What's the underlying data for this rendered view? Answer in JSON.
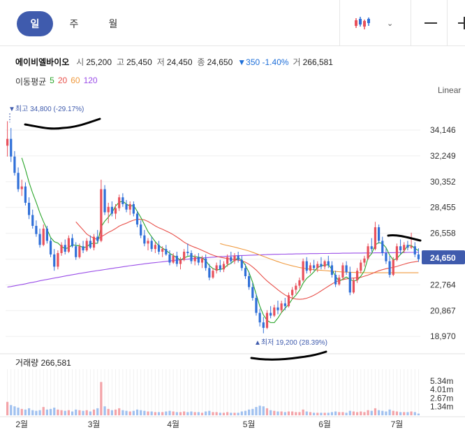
{
  "toolbar": {
    "tabs": [
      {
        "label": "일",
        "active": true
      },
      {
        "label": "주",
        "active": false
      },
      {
        "label": "월",
        "active": false
      }
    ],
    "chart_type_icon": "candlestick-icon",
    "dropdown_icon": "chevron-down-icon",
    "zoom_out_icon": "minus-icon",
    "zoom_in_icon": "plus-icon"
  },
  "stock": {
    "name": "에이비엘바이오",
    "open_label": "시",
    "open": "25,200",
    "high_label": "고",
    "high": "25,450",
    "low_label": "저",
    "low": "24,450",
    "close_label": "종",
    "close": "24,650",
    "change": "▼350 -1.40%",
    "volume_label": "거",
    "volume": "266,581"
  },
  "moving_average": {
    "label": "이동평균",
    "periods": [
      {
        "label": "5",
        "color": "#2aa52a"
      },
      {
        "label": "20",
        "color": "#e8504a"
      },
      {
        "label": "60",
        "color": "#f09a3e"
      },
      {
        "label": "120",
        "color": "#9a4ee8"
      }
    ]
  },
  "scale_mode": "Linear",
  "colors": {
    "up": "#e8505b",
    "down": "#2f6fd8",
    "price_badge": "#3f5bad",
    "accent": "#3f5bad"
  },
  "current_price_badge": "24,650",
  "annotations": {
    "high": "▼최고 34,800 (-29.17%)",
    "low": "▲최저 19,200 (28.39%)"
  },
  "volume_title": "거래량 266,581",
  "chart_data": {
    "type": "candlestick",
    "price_axis": {
      "ticks": [
        34146,
        32249,
        30352,
        28455,
        26558,
        24650,
        22764,
        20867,
        18970
      ],
      "tick_labels": [
        "34,146",
        "32,249",
        "30,352",
        "28,455",
        "26,558",
        "24,650",
        "22,764",
        "20,867",
        "18,970"
      ],
      "range": [
        18000,
        36000
      ]
    },
    "volume_axis": {
      "tick_labels": [
        "5.34m",
        "4.01m",
        "2.67m",
        "1.34m"
      ],
      "ticks": [
        5.34,
        4.01,
        2.67,
        1.34
      ],
      "range": [
        0,
        7.2
      ]
    },
    "x_labels": [
      "2월",
      "3월",
      "4월",
      "5월",
      "6월",
      "7월"
    ],
    "x_label_index": [
      4,
      24,
      46,
      67,
      88,
      108
    ],
    "high_point": {
      "index": 1,
      "value": 34800
    },
    "low_point": {
      "index": 72,
      "value": 19200
    },
    "candles": [
      [
        33000,
        34800,
        32200,
        33500,
        2.1
      ],
      [
        33500,
        34300,
        31800,
        32200,
        1.6
      ],
      [
        32200,
        32600,
        30800,
        31000,
        1.4
      ],
      [
        31000,
        31400,
        29600,
        29800,
        1.2
      ],
      [
        29800,
        30500,
        29300,
        30000,
        1.0
      ],
      [
        30000,
        30300,
        28600,
        28800,
        0.9
      ],
      [
        28800,
        29200,
        27600,
        27900,
        1.1
      ],
      [
        27900,
        28300,
        26900,
        27100,
        0.8
      ],
      [
        27100,
        27500,
        26300,
        26500,
        0.7
      ],
      [
        26500,
        26900,
        25500,
        25700,
        0.8
      ],
      [
        25700,
        27200,
        25600,
        26900,
        1.3
      ],
      [
        26900,
        27100,
        25800,
        26000,
        0.9
      ],
      [
        26000,
        26200,
        24800,
        25000,
        1.0
      ],
      [
        25000,
        25400,
        23800,
        24100,
        1.2
      ],
      [
        24100,
        25300,
        23900,
        25100,
        0.9
      ],
      [
        25100,
        25900,
        24900,
        25700,
        0.8
      ],
      [
        25700,
        26100,
        25000,
        25200,
        0.7
      ],
      [
        25200,
        26400,
        25100,
        26200,
        0.8
      ],
      [
        26200,
        26500,
        25500,
        25600,
        0.6
      ],
      [
        25600,
        25900,
        24600,
        24800,
        0.9
      ],
      [
        24800,
        25800,
        24700,
        25600,
        0.8
      ],
      [
        25600,
        26000,
        25100,
        25300,
        0.7
      ],
      [
        25300,
        26200,
        25200,
        26000,
        0.8
      ],
      [
        26000,
        26400,
        25400,
        25500,
        0.6
      ],
      [
        25500,
        26500,
        25300,
        26300,
        0.9
      ],
      [
        26300,
        26800,
        25800,
        26000,
        1.1
      ],
      [
        26000,
        30500,
        25900,
        29800,
        5.2
      ],
      [
        29800,
        30100,
        27900,
        28100,
        1.4
      ],
      [
        28100,
        28800,
        27300,
        28500,
        1.0
      ],
      [
        28500,
        28900,
        27800,
        28000,
        0.8
      ],
      [
        28000,
        28700,
        27600,
        28400,
        0.9
      ],
      [
        28400,
        29400,
        28200,
        29200,
        1.1
      ],
      [
        29200,
        29500,
        28500,
        28700,
        0.8
      ],
      [
        28700,
        29000,
        28100,
        28300,
        0.7
      ],
      [
        28300,
        28900,
        27900,
        28700,
        0.6
      ],
      [
        28700,
        28900,
        27800,
        28000,
        0.7
      ],
      [
        28000,
        28200,
        27000,
        27200,
        0.9
      ],
      [
        27200,
        27500,
        26200,
        26400,
        0.8
      ],
      [
        26400,
        26800,
        25600,
        25800,
        0.7
      ],
      [
        25800,
        26200,
        25300,
        26000,
        0.6
      ],
      [
        26000,
        26300,
        25200,
        25400,
        0.6
      ],
      [
        25400,
        25900,
        25100,
        25700,
        0.5
      ],
      [
        25700,
        26000,
        25000,
        25200,
        0.5
      ],
      [
        25200,
        25600,
        24800,
        25400,
        0.5
      ],
      [
        25400,
        25700,
        24900,
        25000,
        0.6
      ],
      [
        25000,
        25300,
        24200,
        24400,
        0.7
      ],
      [
        24400,
        25100,
        24300,
        24900,
        0.6
      ],
      [
        24900,
        25200,
        24100,
        24300,
        0.5
      ],
      [
        24300,
        24800,
        23900,
        24600,
        0.5
      ],
      [
        24600,
        25400,
        24500,
        25200,
        0.6
      ],
      [
        25200,
        25800,
        24900,
        25100,
        0.5
      ],
      [
        25100,
        25300,
        24300,
        24500,
        0.6
      ],
      [
        24500,
        25000,
        24200,
        24800,
        0.5
      ],
      [
        24800,
        25100,
        24200,
        24400,
        0.5
      ],
      [
        24400,
        24900,
        24000,
        24700,
        0.4
      ],
      [
        24700,
        25000,
        23800,
        24000,
        0.6
      ],
      [
        24000,
        24300,
        23100,
        23300,
        0.7
      ],
      [
        23300,
        24000,
        23200,
        23800,
        0.5
      ],
      [
        23800,
        24400,
        23600,
        24200,
        0.5
      ],
      [
        24200,
        24600,
        23700,
        23900,
        0.4
      ],
      [
        23900,
        24500,
        23700,
        24300,
        0.4
      ],
      [
        24300,
        25000,
        24100,
        24800,
        0.5
      ],
      [
        24800,
        25200,
        24300,
        24500,
        0.4
      ],
      [
        24500,
        25100,
        24300,
        24900,
        0.4
      ],
      [
        24900,
        25200,
        24400,
        24600,
        0.4
      ],
      [
        24600,
        24900,
        23800,
        24000,
        0.6
      ],
      [
        24000,
        24300,
        23200,
        23400,
        0.7
      ],
      [
        23400,
        23700,
        22400,
        22600,
        0.9
      ],
      [
        22600,
        22900,
        21600,
        21800,
        1.0
      ],
      [
        21800,
        22100,
        20500,
        20700,
        1.3
      ],
      [
        20700,
        21000,
        19700,
        20000,
        1.5
      ],
      [
        20000,
        20400,
        19200,
        19600,
        1.4
      ],
      [
        19600,
        20900,
        19500,
        20700,
        1.1
      ],
      [
        20700,
        21200,
        20300,
        20500,
        0.8
      ],
      [
        20500,
        21300,
        20400,
        21100,
        0.7
      ],
      [
        21100,
        21600,
        20600,
        20900,
        0.6
      ],
      [
        20900,
        21600,
        20700,
        21400,
        0.6
      ],
      [
        21400,
        21800,
        20900,
        21200,
        0.5
      ],
      [
        21200,
        22200,
        21100,
        22000,
        0.6
      ],
      [
        22000,
        22600,
        21700,
        22400,
        0.6
      ],
      [
        22400,
        22900,
        22100,
        22700,
        0.5
      ],
      [
        22700,
        23300,
        22500,
        23100,
        0.5
      ],
      [
        23100,
        24700,
        23000,
        24500,
        0.9
      ],
      [
        24500,
        24800,
        23600,
        23800,
        0.6
      ],
      [
        23800,
        24400,
        23600,
        24200,
        0.5
      ],
      [
        24200,
        24600,
        23800,
        24000,
        0.4
      ],
      [
        24000,
        24500,
        23700,
        24300,
        0.4
      ],
      [
        24300,
        24800,
        23900,
        24100,
        0.4
      ],
      [
        24100,
        24600,
        23900,
        24500,
        0.4
      ],
      [
        24500,
        24900,
        24000,
        24200,
        0.4
      ],
      [
        24200,
        24500,
        23300,
        23500,
        0.5
      ],
      [
        23500,
        23800,
        22600,
        22800,
        0.6
      ],
      [
        22800,
        23500,
        22700,
        23300,
        0.5
      ],
      [
        23300,
        24400,
        23100,
        24200,
        0.5
      ],
      [
        24200,
        24500,
        23500,
        23700,
        0.4
      ],
      [
        23700,
        24100,
        22000,
        22200,
        0.7
      ],
      [
        22200,
        23300,
        22100,
        23100,
        0.6
      ],
      [
        23100,
        24000,
        22900,
        23800,
        0.5
      ],
      [
        23800,
        24600,
        23600,
        24400,
        0.6
      ],
      [
        24400,
        24900,
        24100,
        24700,
        0.5
      ],
      [
        24700,
        25800,
        24600,
        25600,
        0.8
      ],
      [
        25600,
        26200,
        25200,
        25400,
        0.7
      ],
      [
        25400,
        27400,
        25300,
        27000,
        1.1
      ],
      [
        27000,
        27200,
        25800,
        26000,
        0.8
      ],
      [
        26000,
        26300,
        24900,
        25100,
        0.7
      ],
      [
        25100,
        25500,
        24300,
        24500,
        0.6
      ],
      [
        24500,
        24900,
        23300,
        23500,
        0.9
      ],
      [
        23500,
        24800,
        23400,
        24600,
        0.7
      ],
      [
        24600,
        25800,
        24500,
        25600,
        0.6
      ],
      [
        25600,
        26100,
        25000,
        25300,
        0.5
      ],
      [
        25300,
        25900,
        25100,
        25700,
        0.5
      ],
      [
        25700,
        26000,
        25300,
        25500,
        0.5
      ],
      [
        25500,
        26600,
        25400,
        25600,
        0.6
      ],
      [
        25600,
        25900,
        24800,
        25000,
        0.5
      ],
      [
        25000,
        25450,
        24450,
        24650,
        0.27
      ]
    ],
    "ma5": [
      null,
      null,
      null,
      null,
      32100,
      31260,
      30300,
      29520,
      28820,
      28060,
      27420,
      26840,
      26240,
      25940,
      25840,
      25580,
      25420,
      25500,
      25720,
      25660,
      25640,
      25500,
      25560,
      25780,
      25820,
      25820,
      27040,
      27440,
      27740,
      28080,
      28560,
      28840,
      28920,
      28700,
      28560,
      28590,
      28180,
      27720,
      27200,
      26680,
      26300,
      25940,
      25630,
      25460,
      25300,
      25080,
      24930,
      24760,
      24600,
      24740,
      24860,
      24900,
      24840,
      24800,
      24760,
      24540,
      24180,
      23960,
      23860,
      23900,
      23960,
      24220,
      24340,
      24580,
      24740,
      24580,
      24200,
      23660,
      22960,
      22060,
      21200,
      20550,
      20150,
      19990,
      19980,
      20320,
      20720,
      21040,
      21320,
      21720,
      22000,
      22360,
      22880,
      23240,
      23460,
      23720,
      24040,
      24160,
      24220,
      24240,
      23900,
      23380,
      23040,
      23180,
      23340,
      23160,
      23060,
      23100,
      23400,
      23800,
      24740,
      25060,
      25700,
      25880,
      25800,
      25500,
      24950,
      24590,
      24700,
      25000,
      25250,
      25660,
      25660,
      25440,
      25280
    ],
    "ma20": [
      null,
      null,
      null,
      null,
      null,
      null,
      null,
      null,
      null,
      null,
      null,
      null,
      null,
      null,
      null,
      null,
      null,
      null,
      null,
      27400,
      27100,
      26800,
      26500,
      26320,
      26200,
      26100,
      26300,
      26450,
      26620,
      26750,
      26900,
      27080,
      27200,
      27300,
      27420,
      27520,
      27580,
      27580,
      27540,
      27420,
      27270,
      27100,
      26960,
      26850,
      26720,
      26600,
      26450,
      26280,
      26100,
      25900,
      25750,
      25620,
      25520,
      25420,
      25300,
      25180,
      25050,
      24950,
      24860,
      24800,
      24750,
      24700,
      24650,
      24620,
      24580,
      24520,
      24430,
      24280,
      24080,
      23850,
      23580,
      23300,
      23050,
      22830,
      22620,
      22400,
      22200,
      22020,
      21880,
      21780,
      21720,
      21700,
      21720,
      21780,
      21880,
      22000,
      22150,
      22320,
      22490,
      22660,
      22830,
      22980,
      23080,
      23150,
      23200,
      23240,
      23260,
      23280,
      23320,
      23400,
      23480,
      23580,
      23700,
      23800,
      23880,
      23950,
      24000,
      24050,
      24120,
      24200,
      24280,
      24360,
      24420,
      24460,
      24500
    ],
    "ma60": [
      null,
      null,
      null,
      null,
      null,
      null,
      null,
      null,
      null,
      null,
      null,
      null,
      null,
      null,
      null,
      null,
      null,
      null,
      null,
      null,
      null,
      null,
      null,
      null,
      null,
      null,
      null,
      null,
      null,
      null,
      null,
      null,
      null,
      null,
      null,
      null,
      null,
      null,
      null,
      null,
      null,
      null,
      null,
      null,
      null,
      null,
      null,
      null,
      null,
      null,
      null,
      null,
      null,
      null,
      null,
      null,
      null,
      null,
      null,
      25800,
      25720,
      25660,
      25600,
      25540,
      25470,
      25400,
      25330,
      25250,
      25160,
      25060,
      24960,
      24860,
      24760,
      24660,
      24560,
      24470,
      24380,
      24300,
      24230,
      24160,
      24100,
      24040,
      23990,
      23950,
      23910,
      23880,
      23850,
      23830,
      23810,
      23790,
      23770,
      23750,
      23730,
      23710,
      23700,
      23690,
      23680,
      23670,
      23660,
      23660,
      23650,
      23650,
      23650,
      23650,
      23650,
      23650,
      23650,
      23650,
      23650,
      23650,
      23650,
      23650,
      23650,
      23650,
      23650
    ],
    "ma120": [
      22600,
      22640,
      22690,
      22740,
      22790,
      22840,
      22900,
      22950,
      23000,
      23060,
      23110,
      23160,
      23210,
      23260,
      23310,
      23360,
      23410,
      23460,
      23510,
      23550,
      23600,
      23640,
      23690,
      23730,
      23770,
      23810,
      23850,
      23890,
      23930,
      23970,
      24010,
      24050,
      24090,
      24130,
      24170,
      24200,
      24240,
      24270,
      24310,
      24340,
      24370,
      24400,
      24430,
      24460,
      24490,
      24520,
      24550,
      24580,
      24600,
      24630,
      24650,
      24680,
      24700,
      24720,
      24740,
      24760,
      24780,
      24800,
      24820,
      24840,
      24850,
      24870,
      24880,
      24900,
      24910,
      24920,
      24930,
      24940,
      24950,
      24960,
      24970,
      24980,
      24990,
      25000,
      25010,
      25010,
      25020,
      25020,
      25030,
      25030,
      25040,
      25040,
      25050,
      25050,
      25060,
      25060,
      25060,
      25070,
      25070,
      25070,
      25080,
      25080,
      25080,
      25090,
      25090,
      25090,
      25100,
      25100,
      25100,
      25110,
      25110,
      25110,
      25120,
      25120,
      25120,
      25130,
      25130,
      25130,
      25140,
      25140,
      25140,
      25150,
      25150,
      25150,
      25160
    ]
  }
}
